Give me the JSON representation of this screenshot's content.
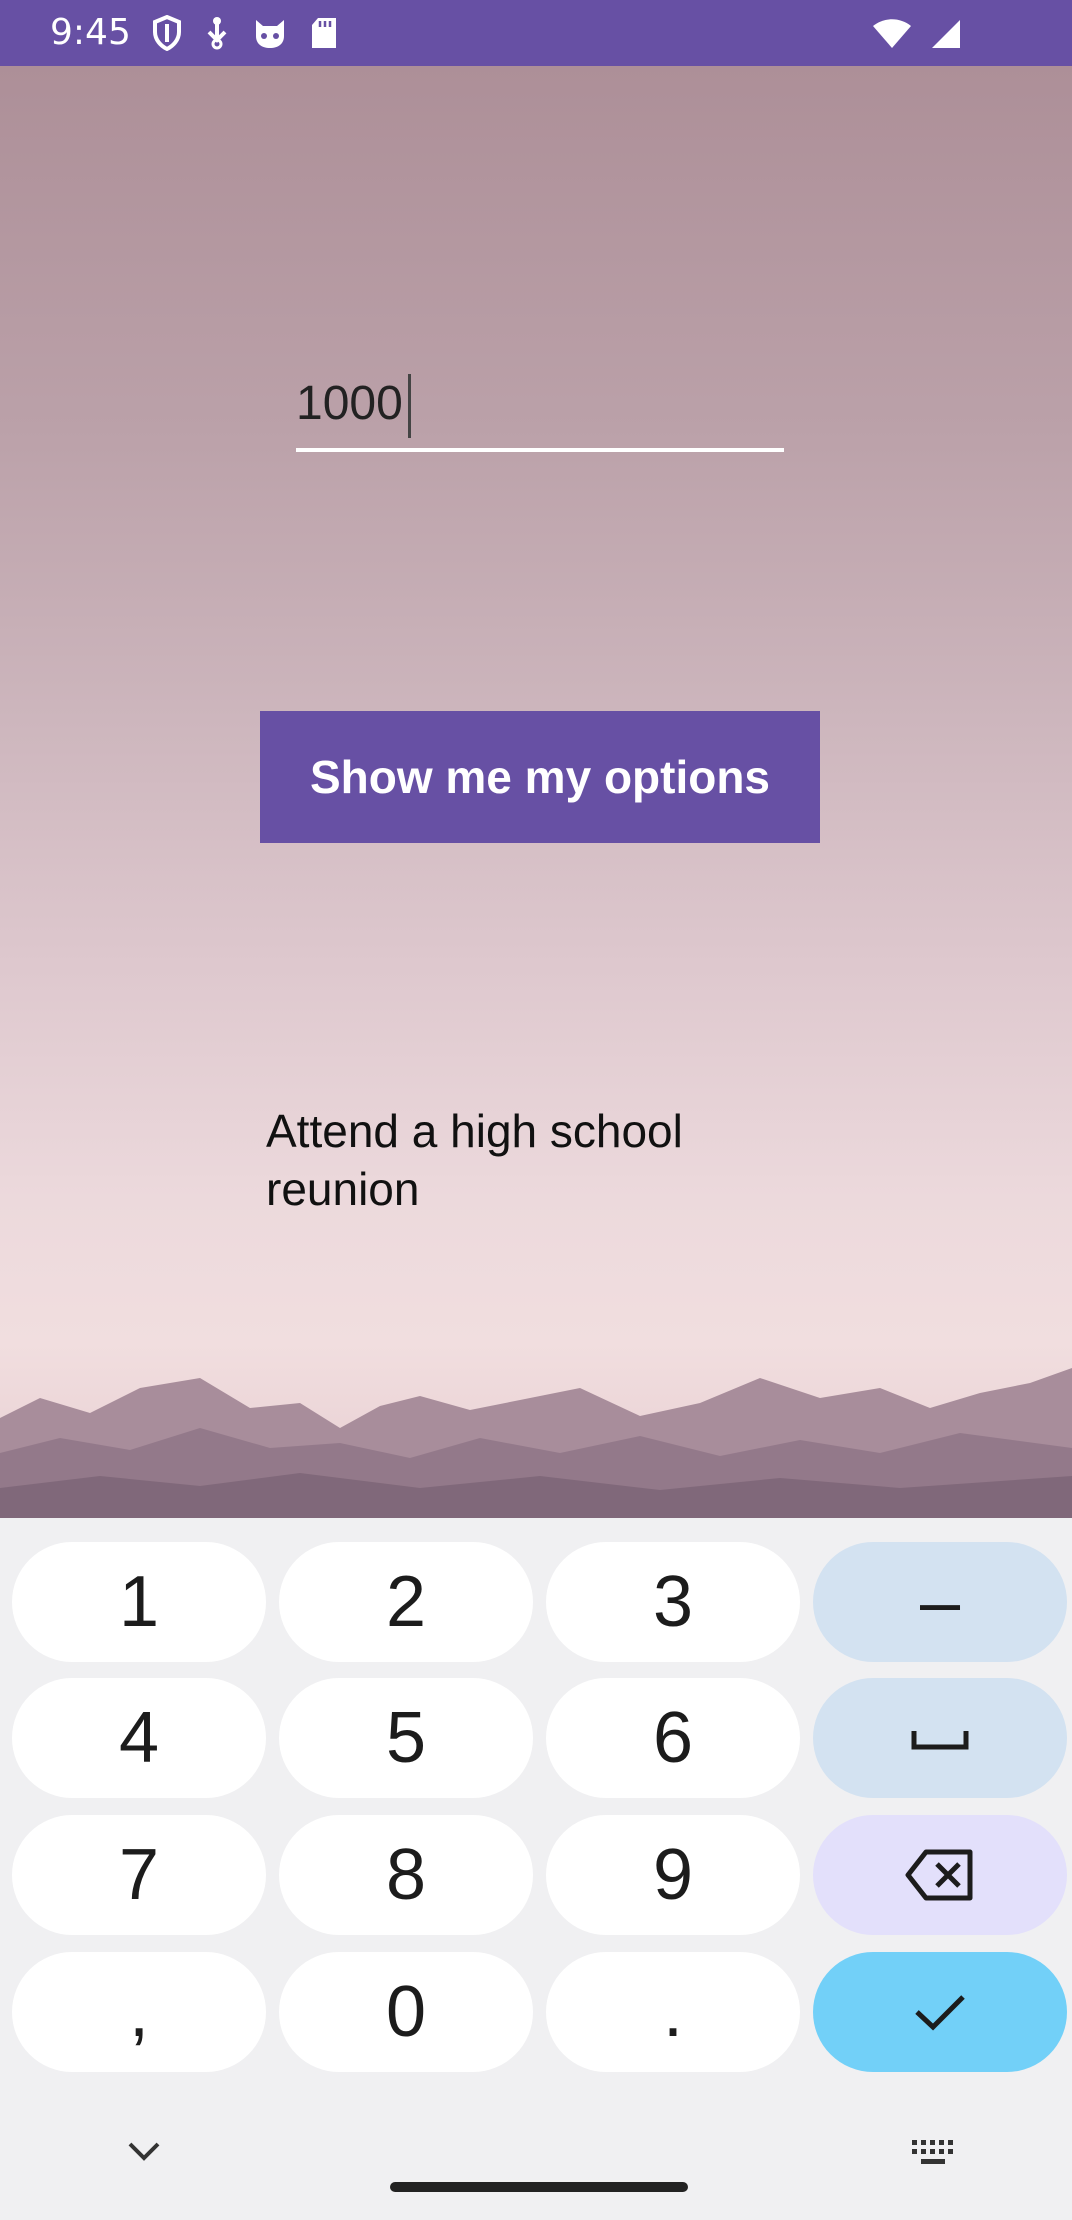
{
  "status_bar": {
    "time": "9:45",
    "left_icons": [
      "shield-icon",
      "usb-icon",
      "cat-icon",
      "sd-card-icon"
    ],
    "right_icons": [
      "wifi-icon",
      "signal-icon"
    ],
    "background": "#6750a4"
  },
  "form": {
    "amount_value": "1000",
    "button_label": "Show me my options",
    "result": "Attend a high school reunion"
  },
  "keyboard": {
    "keys": [
      {
        "label": "1",
        "kind": "digit"
      },
      {
        "label": "2",
        "kind": "digit"
      },
      {
        "label": "3",
        "kind": "digit"
      },
      {
        "label": "–",
        "kind": "symbol"
      },
      {
        "label": "4",
        "kind": "digit"
      },
      {
        "label": "5",
        "kind": "digit"
      },
      {
        "label": "6",
        "kind": "digit"
      },
      {
        "label": "space",
        "kind": "space"
      },
      {
        "label": "7",
        "kind": "digit"
      },
      {
        "label": "8",
        "kind": "digit"
      },
      {
        "label": "9",
        "kind": "digit"
      },
      {
        "label": "backspace",
        "kind": "backspace"
      },
      {
        "label": ",",
        "kind": "digit"
      },
      {
        "label": "0",
        "kind": "digit"
      },
      {
        "label": ".",
        "kind": "digit"
      },
      {
        "label": "done",
        "kind": "enter"
      }
    ],
    "colors": {
      "accent": "#6750a4",
      "enter": "#72d0f8",
      "symbol": "#d3e2f1",
      "backspace": "#e3e0fb"
    }
  }
}
